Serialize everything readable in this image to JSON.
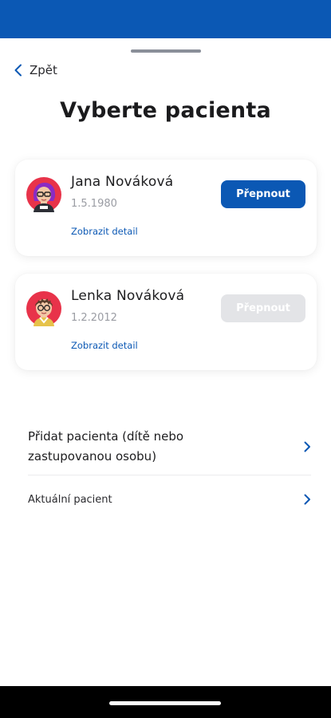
{
  "nav": {
    "back_label": "Zpět"
  },
  "page": {
    "title": "Vyberte pacienta"
  },
  "patients": [
    {
      "name": "Jana Nováková",
      "dob": "1.5.1980",
      "detail_label": "Zobrazit detail",
      "switch_label": "Přepnout",
      "switch_enabled": true,
      "avatar_icon": "woman-avatar-icon"
    },
    {
      "name": "Lenka Nováková",
      "dob": "1.2.2012",
      "detail_label": "Zobrazit detail",
      "switch_label": "Přepnout",
      "switch_enabled": false,
      "avatar_icon": "child-avatar-icon"
    }
  ],
  "menu": {
    "add_patient": "Přidat pacienta (dítě nebo zastupovanou osobu)",
    "current_patient": "Aktuální pacient"
  },
  "colors": {
    "brand": "#0b58b4",
    "disabled": "#e3e4e7",
    "muted": "#9a9ca3"
  }
}
